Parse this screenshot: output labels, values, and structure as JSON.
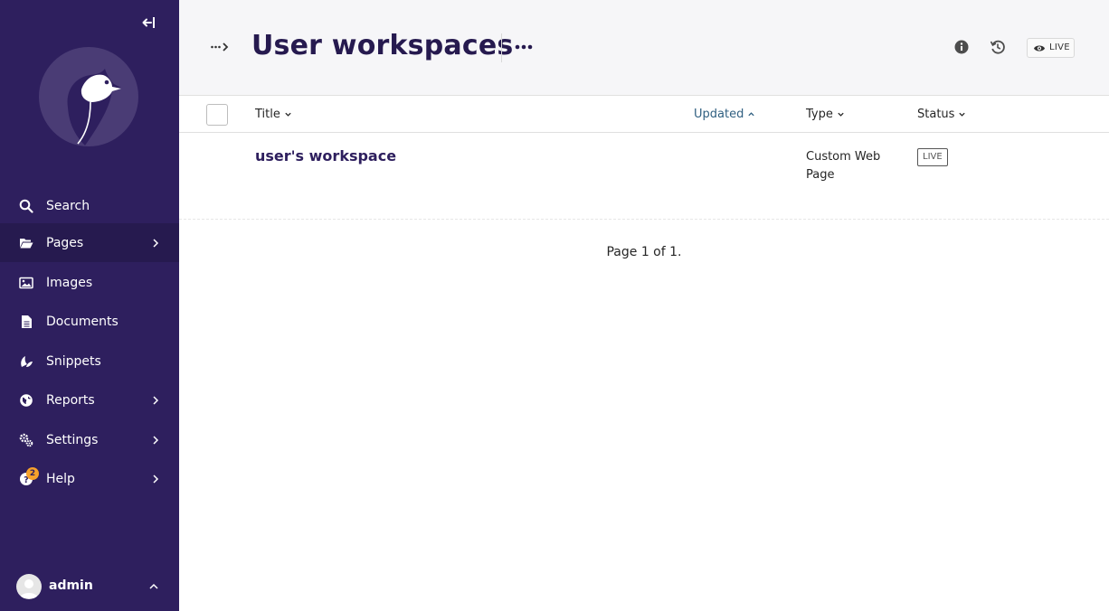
{
  "sidebar": {
    "items": [
      {
        "label": "Search",
        "icon": "search-icon"
      },
      {
        "label": "Pages",
        "icon": "folder-open-icon"
      },
      {
        "label": "Images",
        "icon": "image-icon"
      },
      {
        "label": "Documents",
        "icon": "document-icon"
      },
      {
        "label": "Snippets",
        "icon": "snippet-icon"
      },
      {
        "label": "Reports",
        "icon": "globe-icon"
      },
      {
        "label": "Settings",
        "icon": "cogs-icon"
      },
      {
        "label": "Help",
        "icon": "help-icon",
        "badge": "2"
      }
    ],
    "account": {
      "name": "admin"
    },
    "colors": {
      "background": "#2e1f5e",
      "active": "#261a4f",
      "badge": "#f7a12b"
    }
  },
  "header": {
    "title": "User workspaces",
    "live_label": "LIVE"
  },
  "listing": {
    "columns": {
      "title": "Title",
      "updated": "Updated",
      "type": "Type",
      "status": "Status"
    },
    "rows": [
      {
        "title": "user's workspace",
        "updated": "",
        "type": "Custom Web Page",
        "status": "LIVE"
      }
    ]
  },
  "pagination": {
    "text": "Page 1 of 1."
  }
}
